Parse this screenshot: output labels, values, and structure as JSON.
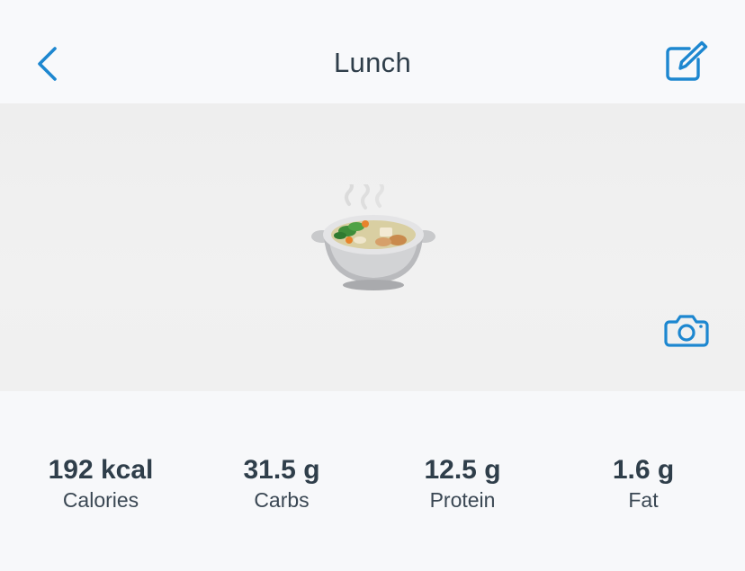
{
  "header": {
    "title": "Lunch",
    "back_icon": "chevron-left-icon",
    "edit_icon": "edit-icon"
  },
  "hero": {
    "image_icon": "soup-bowl-icon",
    "camera_icon": "camera-icon"
  },
  "stats": [
    {
      "value": "192 kcal",
      "label": "Calories"
    },
    {
      "value": "31.5 g",
      "label": "Carbs"
    },
    {
      "value": "12.5 g",
      "label": "Protein"
    },
    {
      "value": "1.6 g",
      "label": "Fat"
    }
  ],
  "colors": {
    "accent": "#1d87d0",
    "text": "#2f3e4a",
    "background": "#f7f8fa",
    "hero_background": "#efefef"
  }
}
